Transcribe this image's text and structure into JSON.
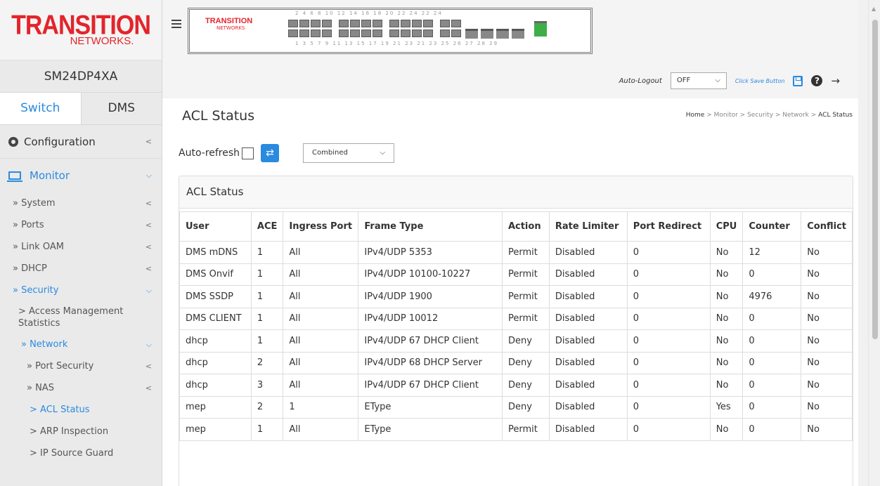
{
  "brand": {
    "main": "TRANSITION",
    "sub": "NETWORKS."
  },
  "device_name": "SM24DP4XA",
  "tabs": [
    {
      "label": "Switch"
    },
    {
      "label": "DMS"
    }
  ],
  "nav": {
    "configuration": "Configuration",
    "monitor": "Monitor",
    "items": [
      {
        "label": "» System"
      },
      {
        "label": "» Ports"
      },
      {
        "label": "» Link OAM"
      },
      {
        "label": "» DHCP"
      },
      {
        "label": "» Security"
      },
      {
        "label": "> Access Management Statistics"
      },
      {
        "label": "» Network"
      },
      {
        "label": "» Port Security"
      },
      {
        "label": "» NAS"
      },
      {
        "label": "> ACL Status"
      },
      {
        "label": "> ARP Inspection"
      },
      {
        "label": "> IP Source Guard"
      }
    ]
  },
  "panel": {
    "logo": "TRANSITION",
    "logo_sub": "NETWORKS",
    "top_numbers": "2 4 6 8 10 12 14 16 18 20 22 24 22 24",
    "bottom_numbers": "1 3 5 7 9 11 13 15 17 19 21 23 21 23 25 26 27 28 29"
  },
  "toolbar": {
    "auto_logout_label": "Auto-Logout",
    "auto_logout_value": "OFF",
    "save_link": "Click Save Button"
  },
  "page": {
    "title": "ACL Status",
    "breadcrumb": {
      "home": "Home",
      "path": " > Monitor > Security > Network > ",
      "current": "ACL Status"
    },
    "auto_refresh_label": "Auto-refresh",
    "filter_value": "Combined",
    "card_title": "ACL Status"
  },
  "table": {
    "headers": [
      "User",
      "ACE",
      "Ingress Port",
      "Frame Type",
      "Action",
      "Rate Limiter",
      "Port Redirect",
      "CPU",
      "Counter",
      "Conflict"
    ],
    "rows": [
      [
        "DMS mDNS",
        "1",
        "All",
        "IPv4/UDP 5353",
        "Permit",
        "Disabled",
        "0",
        "No",
        "12",
        "No"
      ],
      [
        "DMS Onvif",
        "1",
        "All",
        "IPv4/UDP 10100-10227",
        "Permit",
        "Disabled",
        "0",
        "No",
        "0",
        "No"
      ],
      [
        "DMS SSDP",
        "1",
        "All",
        "IPv4/UDP 1900",
        "Permit",
        "Disabled",
        "0",
        "No",
        "4976",
        "No"
      ],
      [
        "DMS CLIENT",
        "1",
        "All",
        "IPv4/UDP 10012",
        "Permit",
        "Disabled",
        "0",
        "No",
        "0",
        "No"
      ],
      [
        "dhcp",
        "1",
        "All",
        "IPv4/UDP 67 DHCP Client",
        "Deny",
        "Disabled",
        "0",
        "No",
        "0",
        "No"
      ],
      [
        "dhcp",
        "2",
        "All",
        "IPv4/UDP 68 DHCP Server",
        "Deny",
        "Disabled",
        "0",
        "No",
        "0",
        "No"
      ],
      [
        "dhcp",
        "3",
        "All",
        "IPv4/UDP 67 DHCP Client",
        "Deny",
        "Disabled",
        "0",
        "No",
        "0",
        "No"
      ],
      [
        "mep",
        "2",
        "1",
        "EType",
        "Deny",
        "Disabled",
        "0",
        "Yes",
        "0",
        "No"
      ],
      [
        "mep",
        "1",
        "All",
        "EType",
        "Permit",
        "Disabled",
        "0",
        "No",
        "0",
        "No"
      ]
    ]
  }
}
